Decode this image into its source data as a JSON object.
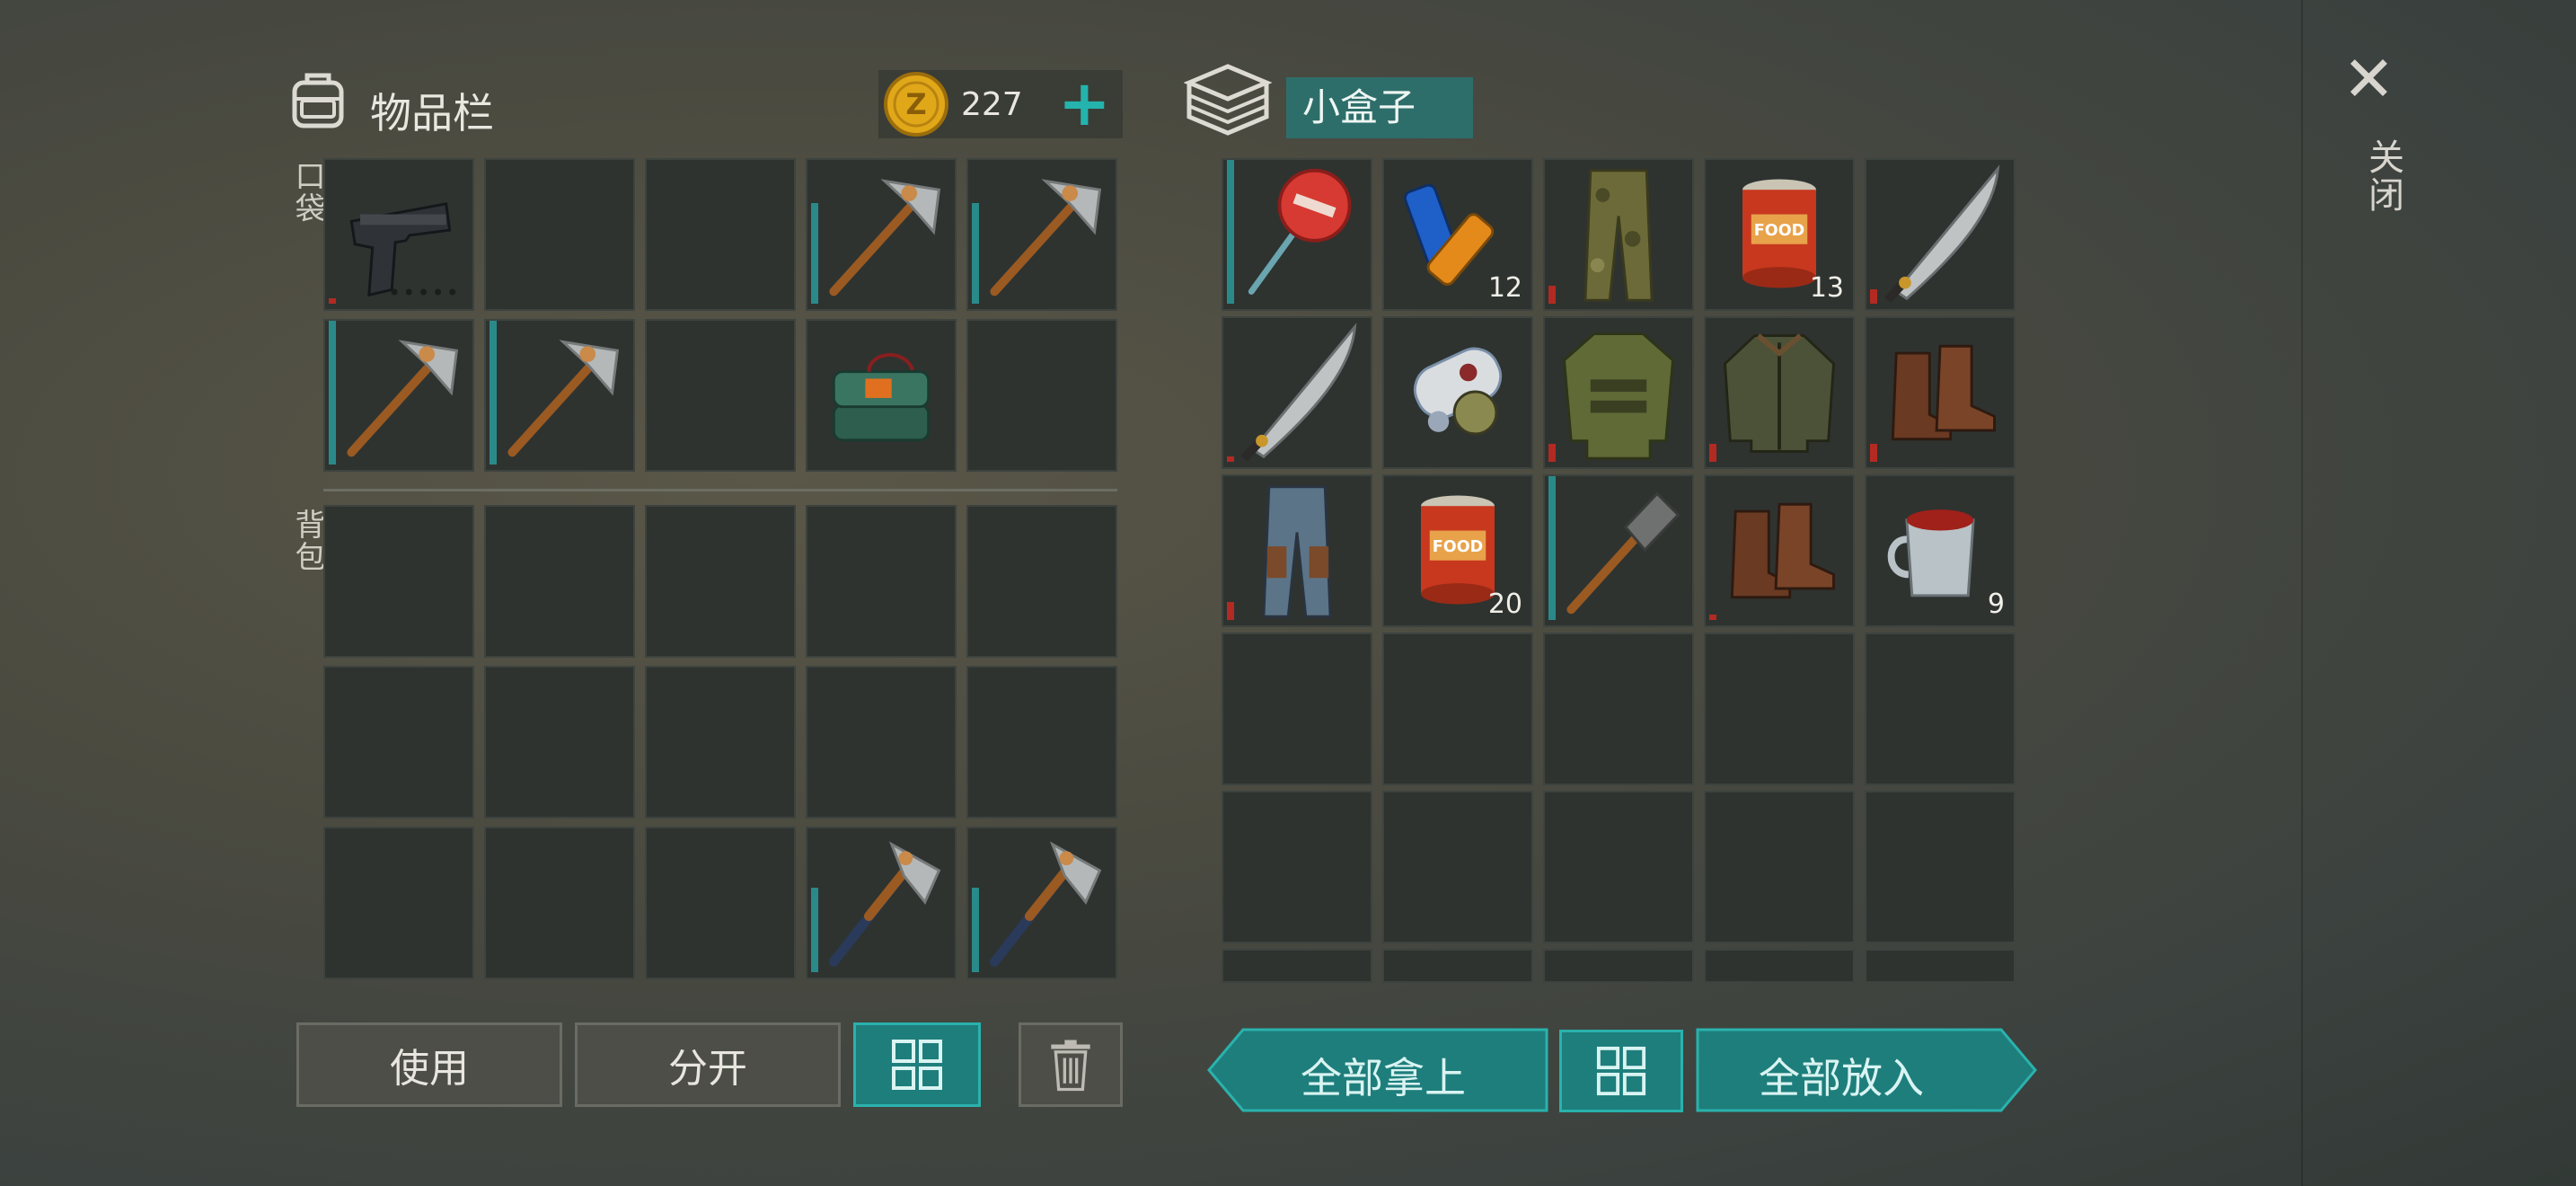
{
  "inventory": {
    "title": "物品栏",
    "coins": "227",
    "add_symbol": "+",
    "pocket_label": "口袋",
    "backpack_label": "背包",
    "gun_ammo_dots": "•••••"
  },
  "container": {
    "title": "小盒子",
    "counts": {
      "batteries": "12",
      "canned_food_a": "13",
      "canned_food_b": "20",
      "mug": "9"
    }
  },
  "side": {
    "close_symbol": "✕",
    "close_label": "关闭"
  },
  "buttons": {
    "use": "使用",
    "split": "分开",
    "take_all": "全部拿上",
    "put_all": "全部放入"
  },
  "colors": {
    "accent": "#1e7e7c",
    "accent_border": "#2ab2ad",
    "durability": "#2a8a8a",
    "damaged": "#b22a22"
  }
}
